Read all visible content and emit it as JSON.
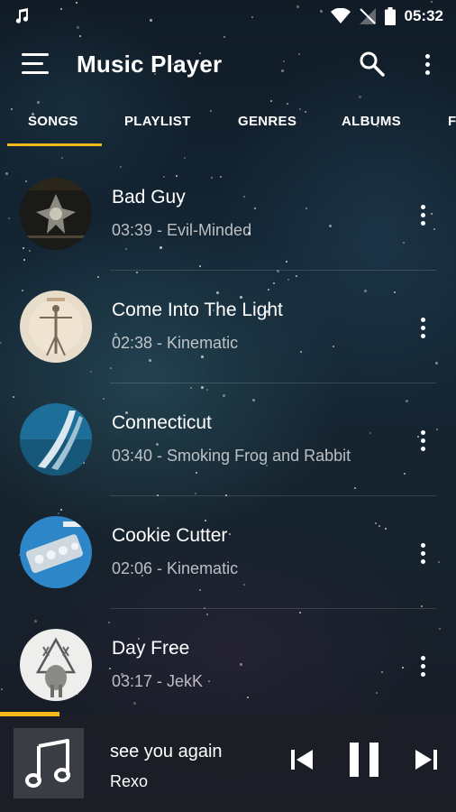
{
  "status_bar": {
    "time": "05:32",
    "icons": [
      "music-note-icon",
      "wifi-icon",
      "no-signal-icon",
      "battery-icon"
    ]
  },
  "app_bar": {
    "title": "Music Player",
    "icons": [
      "menu-icon",
      "search-icon",
      "more-vert-icon"
    ]
  },
  "tabs": [
    {
      "label": "SONGS",
      "selected": true
    },
    {
      "label": "PLAYLIST",
      "selected": false
    },
    {
      "label": "GENRES",
      "selected": false
    },
    {
      "label": "ALBUMS",
      "selected": false
    },
    {
      "label": "F",
      "selected": false
    }
  ],
  "songs": [
    {
      "title": "Bad Guy",
      "subtitle": "03:39 - Evil-Minded"
    },
    {
      "title": "Come Into The Light",
      "subtitle": "02:38 - Kinematic"
    },
    {
      "title": "Connecticut",
      "subtitle": "03:40 - Smoking Frog and Rabbit"
    },
    {
      "title": "Cookie Cutter",
      "subtitle": "02:06 - Kinematic"
    },
    {
      "title": "Day Free",
      "subtitle": "03:17 - JekK"
    }
  ],
  "now_playing": {
    "title": "see you again",
    "artist": "Rexo",
    "progress_fraction": 0.13,
    "controls": [
      "skip-previous-icon",
      "pause-icon",
      "skip-next-icon"
    ]
  },
  "colors": {
    "accent": "#f5b91b",
    "text_primary": "#ffffff",
    "text_secondary": "#b3b3b3",
    "player_bar": "#1c1e26"
  }
}
